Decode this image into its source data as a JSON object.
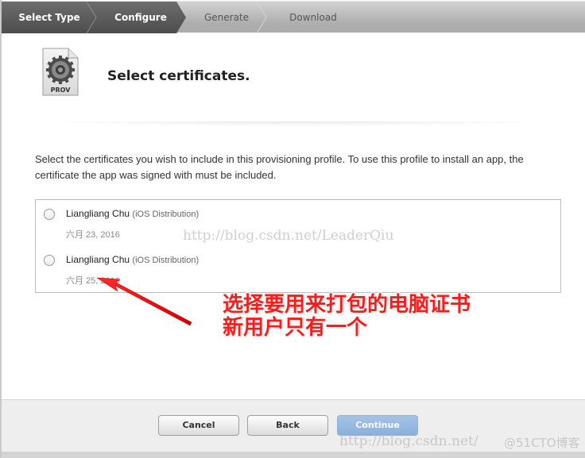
{
  "steps": [
    {
      "label": "Select Type",
      "state": "done"
    },
    {
      "label": "Configure",
      "state": "current"
    },
    {
      "label": "Generate",
      "state": "todo"
    },
    {
      "label": "Download",
      "state": "todo"
    }
  ],
  "header": {
    "icon_label": "PROV",
    "icon": "provisioning-profile-gear-icon",
    "title": "Select certificates."
  },
  "description": "Select the certificates you wish to include in this provisioning profile. To use this profile to install an app, the certificate the app was signed with must be included.",
  "certificates": [
    {
      "name": "Liangliang Chu",
      "type": "(iOS Distribution)",
      "date": "六月 23, 2016",
      "selected": false
    },
    {
      "name": "Liangliang Chu",
      "type": "(iOS Distribution)",
      "date": "六月 25, 2016",
      "selected": false
    }
  ],
  "annotation": {
    "line1": "选择要用来打包的电脑证书",
    "line2": "新用户只有一个",
    "color": "#ff1a1a"
  },
  "watermarks": {
    "center": "http://blog.csdn.net/LeaderQiu",
    "footer_url": "http://blog.csdn.net/",
    "footer_brand": "@51CTO博客"
  },
  "buttons": {
    "cancel": "Cancel",
    "back": "Back",
    "continue": "Continue"
  },
  "colors": {
    "step_done_bg": "#5a5a5a",
    "step_todo_bg": "#b4b4b4",
    "continue_button": "#9bbde4",
    "footer_bg": "#eeeeee"
  }
}
